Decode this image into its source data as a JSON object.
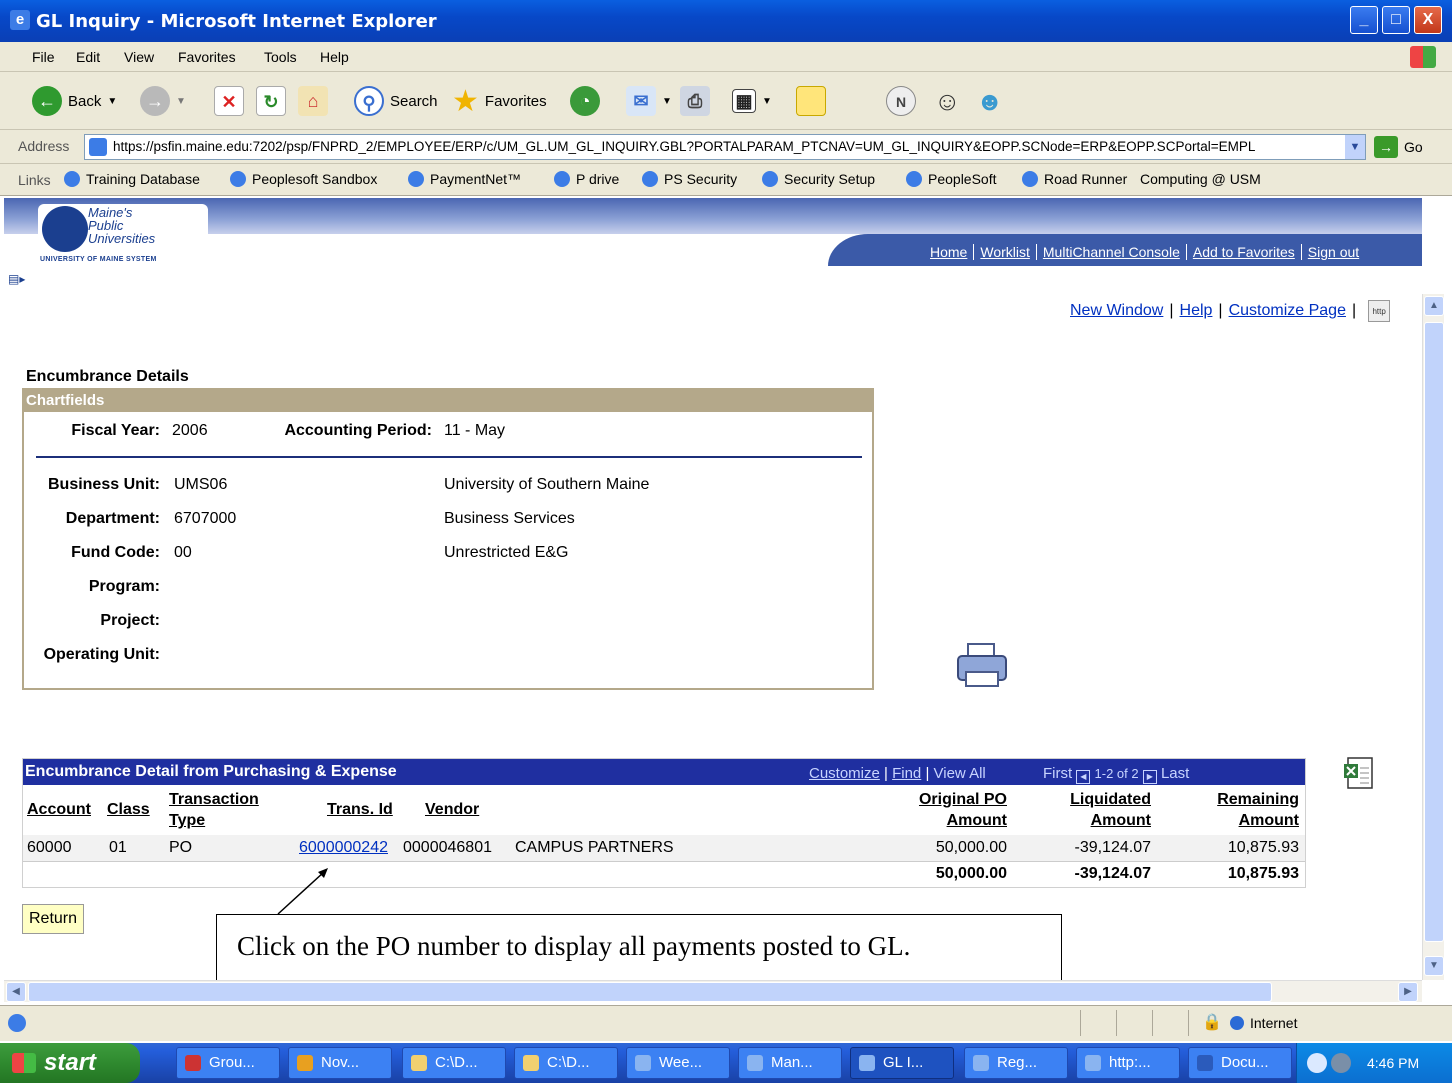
{
  "window": {
    "title": "GL Inquiry - Microsoft Internet Explorer",
    "buttons": {
      "minimize": "_",
      "maximize": "□",
      "close": "X"
    }
  },
  "menu": [
    "File",
    "Edit",
    "View",
    "Favorites",
    "Tools",
    "Help"
  ],
  "toolbar": {
    "back": "Back",
    "search": "Search",
    "favorites": "Favorites"
  },
  "address": {
    "label": "Address",
    "url": "https://psfin.maine.edu:7202/psp/FNPRD_2/EMPLOYEE/ERP/c/UM_GL.UM_GL_INQUIRY.GBL?PORTALPARAM_PTCNAV=UM_GL_INQUIRY&EOPP.SCNode=ERP&EOPP.SCPortal=EMPL",
    "go": "Go"
  },
  "links": {
    "label": "Links",
    "items": [
      "Training Database",
      "Peoplesoft Sandbox",
      "PaymentNet™",
      "P drive",
      "PS Security",
      "Security Setup",
      "PeopleSoft",
      "Road Runner",
      "Computing @ USM"
    ]
  },
  "logo": {
    "line1": "Maine's",
    "line2": "Public",
    "line3": "Universities",
    "system": "UNIVERSITY OF MAINE SYSTEM"
  },
  "portal_nav": [
    "Home",
    "Worklist",
    "MultiChannel Console",
    "Add to Favorites",
    "Sign out"
  ],
  "page_links": [
    "New Window",
    "Help",
    "Customize Page"
  ],
  "page": {
    "section_title": "Encumbrance Details",
    "chartfields_header": "Chartfields",
    "fiscal_year_label": "Fiscal Year:",
    "fiscal_year": "2006",
    "accounting_period_label": "Accounting Period:",
    "accounting_period": "11 - May",
    "business_unit_label": "Business Unit:",
    "business_unit": "UMS06",
    "business_unit_desc": "University of Southern Maine",
    "department_label": "Department:",
    "department": "6707000",
    "department_desc": "Business Services",
    "fund_code_label": "Fund Code:",
    "fund_code": "00",
    "fund_code_desc": "Unrestricted E&G",
    "program_label": "Program:",
    "project_label": "Project:",
    "operating_unit_label": "Operating Unit:"
  },
  "grid": {
    "title": "Encumbrance Detail from Purchasing & Expense",
    "customize": "Customize",
    "find": "Find",
    "view_all": "View All",
    "first": "First",
    "range": "1-2 of 2",
    "last": "Last",
    "headers": {
      "account": "Account",
      "class": "Class",
      "transaction_type_1": "Transaction",
      "transaction_type_2": "Type",
      "trans_id": "Trans. Id",
      "vendor": "Vendor",
      "original_1": "Original PO",
      "original_2": "Amount",
      "liquidated_1": "Liquidated",
      "liquidated_2": "Amount",
      "remaining_1": "Remaining",
      "remaining_2": "Amount"
    },
    "row": {
      "account": "60000",
      "class": "01",
      "type": "PO",
      "trans_id": "6000000242",
      "vendor_id": "0000046801",
      "vendor_name": "CAMPUS PARTNERS",
      "original": "50,000.00",
      "liquidated": "-39,124.07",
      "remaining": "10,875.93"
    },
    "totals": {
      "original": "50,000.00",
      "liquidated": "-39,124.07",
      "remaining": "10,875.93"
    }
  },
  "return_button": "Return",
  "callout": "Click on the PO number to display all payments posted to GL.",
  "status": {
    "zone": "Internet"
  },
  "taskbar": {
    "start": "start",
    "tasks": [
      "Grou...",
      "Nov...",
      "C:\\D...",
      "C:\\D...",
      "Wee...",
      "Man...",
      "GL I...",
      "Reg...",
      "http:...",
      "Docu..."
    ],
    "clock": "4:46 PM"
  }
}
